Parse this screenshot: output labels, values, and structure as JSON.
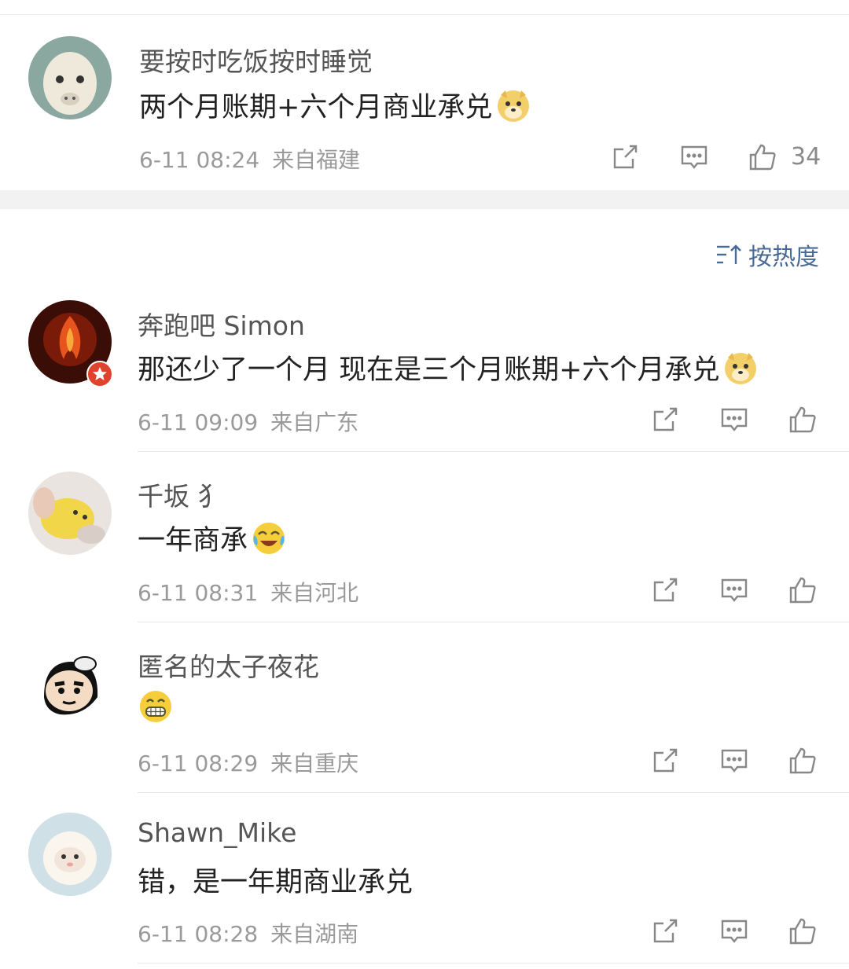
{
  "first_comment": {
    "username": "要按时吃饭按时睡觉",
    "text": "两个月账期+六个月商业承兑",
    "time": "6-11 08:24",
    "location": "来自福建",
    "likes": "34"
  },
  "sort": {
    "label": "按热度"
  },
  "comments": [
    {
      "username": "奔跑吧 Simon",
      "text": "那还少了一个月 现在是三个月账期+六个月承兑",
      "time": "6-11 09:09",
      "location": "来自广东"
    },
    {
      "username": "千坂 犭",
      "text": "一年商承",
      "time": "6-11 08:31",
      "location": "来自河北"
    },
    {
      "username": "匿名的太子夜花",
      "text": "",
      "time": "6-11 08:29",
      "location": "来自重庆"
    },
    {
      "username": "Shawn_Mike",
      "text": "错，是一年期商业承兑",
      "time": "6-11 08:28",
      "location": "来自湖南"
    }
  ]
}
